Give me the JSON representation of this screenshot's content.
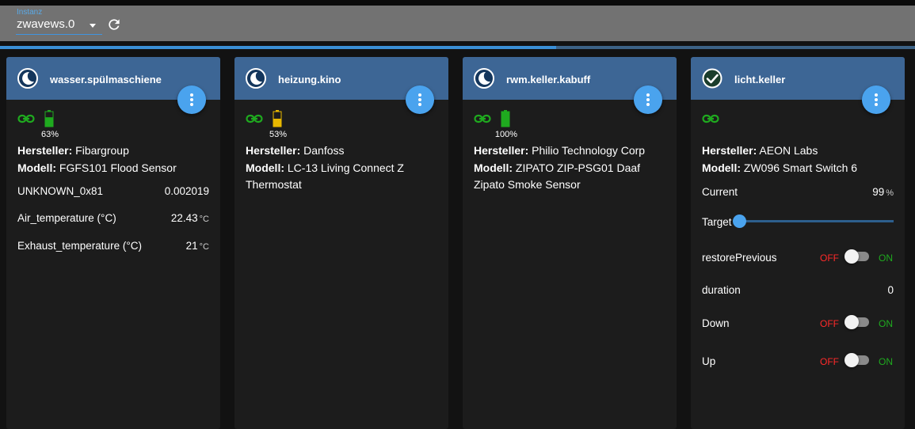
{
  "toolbar": {
    "instance_label": "Instanz",
    "instance_value": "zwavews.0",
    "refresh_icon": "refresh-icon",
    "progress": 0.608
  },
  "colors": {
    "header": "#3d6695",
    "accent": "#4aa3ee",
    "online": "#1faa1f",
    "off_red": "#ff2a2a",
    "battery_warn": "#e8b800"
  },
  "cards": [
    {
      "title": "wasser.spülmaschiene",
      "state_icon": "moon-icon",
      "battery_pct": "63%",
      "battery_level": 0.63,
      "info": [
        {
          "label": "Hersteller:",
          "value": "Fibargroup"
        },
        {
          "label": "Modell:",
          "value": "FGFS101 Flood Sensor"
        }
      ],
      "rows": [
        {
          "label": "UNKNOWN_0x81",
          "value": "0.002019",
          "unit": ""
        },
        {
          "label": "Air_temperature (°C)",
          "value": "22.43",
          "unit": "°C"
        },
        {
          "label": "Exhaust_temperature (°C)",
          "value": "21",
          "unit": "°C"
        }
      ]
    },
    {
      "title": "heizung.kino",
      "state_icon": "moon-icon",
      "battery_pct": "53%",
      "battery_level": 0.53,
      "info": [
        {
          "label": "Hersteller:",
          "value": "Danfoss"
        },
        {
          "label": "Modell:",
          "value": "LC-13 Living Connect Z Thermostat"
        }
      ]
    },
    {
      "title": "rwm.keller.kabuff",
      "state_icon": "moon-icon",
      "battery_pct": "100%",
      "battery_level": 1.0,
      "info": [
        {
          "label": "Hersteller:",
          "value": "Philio Technology Corp"
        },
        {
          "label": "Modell:",
          "value": "ZIPATO ZIP-PSG01 Daaf Zipato Smoke Sensor"
        }
      ]
    },
    {
      "title": "licht.keller",
      "state_icon": "check-circle-icon",
      "info": [
        {
          "label": "Hersteller:",
          "value": "AEON Labs"
        },
        {
          "label": "Modell:",
          "value": "ZW096 Smart Switch 6"
        }
      ],
      "current": {
        "label": "Current",
        "value": "99",
        "unit": "%"
      },
      "target": {
        "label": "Target",
        "level": 0.0
      },
      "switches": [
        {
          "label": "restorePrevious",
          "off": "OFF",
          "on": "ON",
          "state": false
        },
        {
          "label": "Down",
          "off": "OFF",
          "on": "ON",
          "state": false
        },
        {
          "label": "Up",
          "off": "OFF",
          "on": "ON",
          "state": false
        }
      ],
      "duration": {
        "label": "duration",
        "value": "0"
      }
    }
  ]
}
